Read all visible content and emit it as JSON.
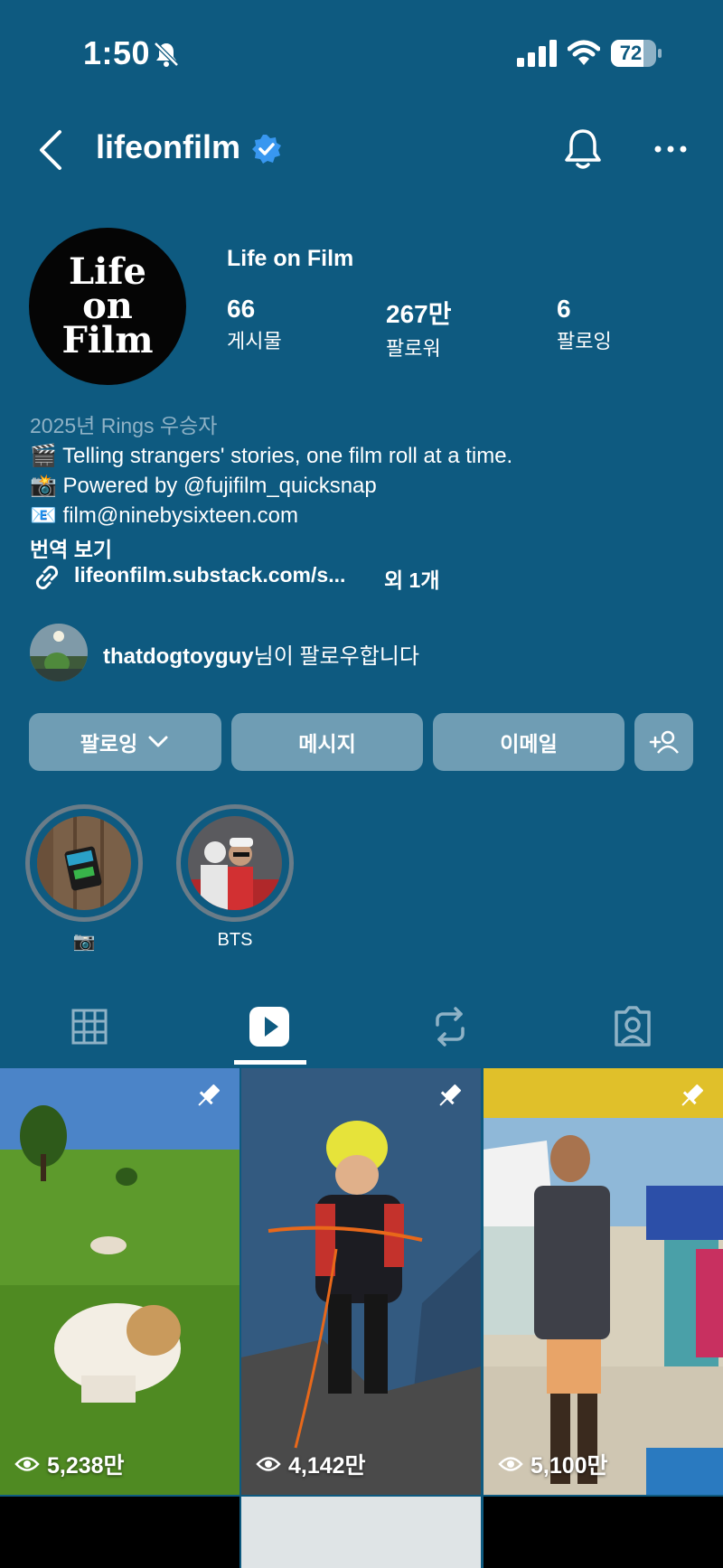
{
  "status_bar": {
    "time": "1:50",
    "battery": "72"
  },
  "header": {
    "username": "lifeonfilm"
  },
  "profile": {
    "display_name": "Life on Film",
    "avatar_logo_text": [
      "Life",
      "on",
      "Film"
    ],
    "stats": [
      {
        "value": "66",
        "label": "게시물"
      },
      {
        "value": "267만",
        "label": "팔로워"
      },
      {
        "value": "6",
        "label": "팔로잉"
      }
    ]
  },
  "bio": {
    "award": "2025년 Rings 우승자",
    "lines": [
      "🎬 Telling strangers' stories, one film roll at a time.",
      "📸 Powered by @fujifilm_quicksnap",
      "📧 film@ninebysixteen.com"
    ],
    "translate": "번역 보기",
    "link": "lifeonfilm.substack.com/s...",
    "link_more": "외 1개"
  },
  "followed_by": {
    "user": "thatdogtoyguy",
    "suffix": "님이 팔로우합니다"
  },
  "buttons": {
    "following": "팔로잉",
    "message": "메시지",
    "email": "이메일"
  },
  "highlights": [
    {
      "label": "📷"
    },
    {
      "label": "BTS"
    }
  ],
  "tabs": [
    "posts-grid",
    "reels",
    "reposts",
    "tagged"
  ],
  "reels": [
    {
      "views": "5,238만",
      "pinned": true
    },
    {
      "views": "4,142만",
      "pinned": true
    },
    {
      "views": "5,100만",
      "pinned": true
    }
  ],
  "colors": {
    "background": "#0e5a80",
    "button": "#6f9db4",
    "verified": "#3897f0"
  }
}
